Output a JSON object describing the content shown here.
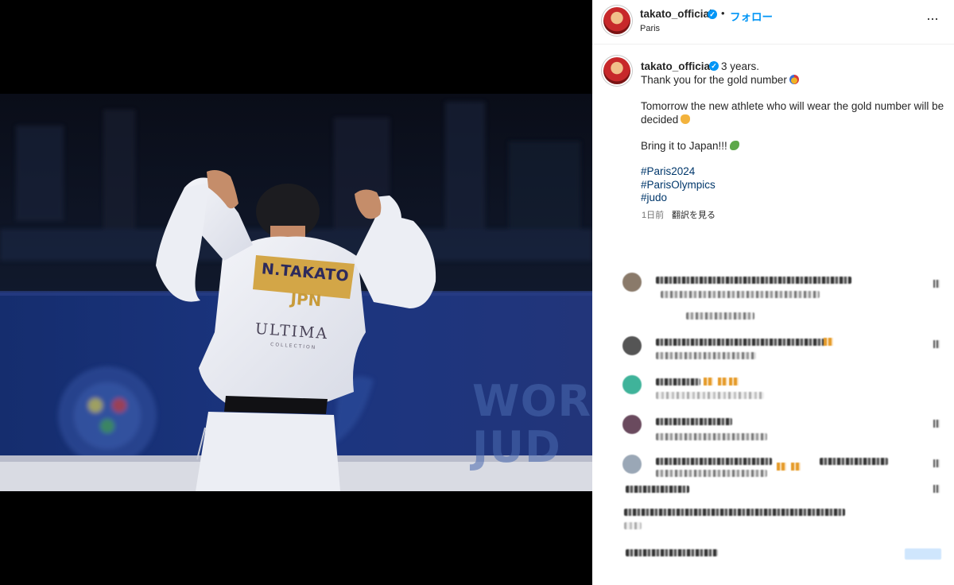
{
  "photo": {
    "bib_name": "N.TAKATO",
    "bib_country": "JPN",
    "sponsor": "ULTIMA",
    "sponsor_sub": "COLLECTION",
    "banner_line1": "WORL",
    "banner_line2": "JUD"
  },
  "header": {
    "username": "takato_official",
    "separator": "•",
    "follow_label": "フォロー",
    "location": "Paris",
    "more_label": "···"
  },
  "caption": {
    "username": "takato_official",
    "time": "3 years.",
    "line1": "Thank you for the gold number",
    "line2": "Tomorrow the new athlete who will wear the gold number will be",
    "line3": "decided",
    "line4": "Bring it to Japan!!!",
    "tags": [
      "#Paris2024",
      "#ParisOlympics",
      "#judo"
    ],
    "posted_ago": "1日前",
    "translate_label": "翻訳を見る"
  },
  "icons": {
    "verified": "verified-badge-icon",
    "more": "more-options-icon",
    "medal": "gold-medal-emoji",
    "clap": "clapping-hands-emoji",
    "dragon": "dragon-emoji"
  },
  "colors": {
    "link_blue": "#0095f6",
    "hashtag": "#00376b",
    "meta_gray": "#737373"
  }
}
